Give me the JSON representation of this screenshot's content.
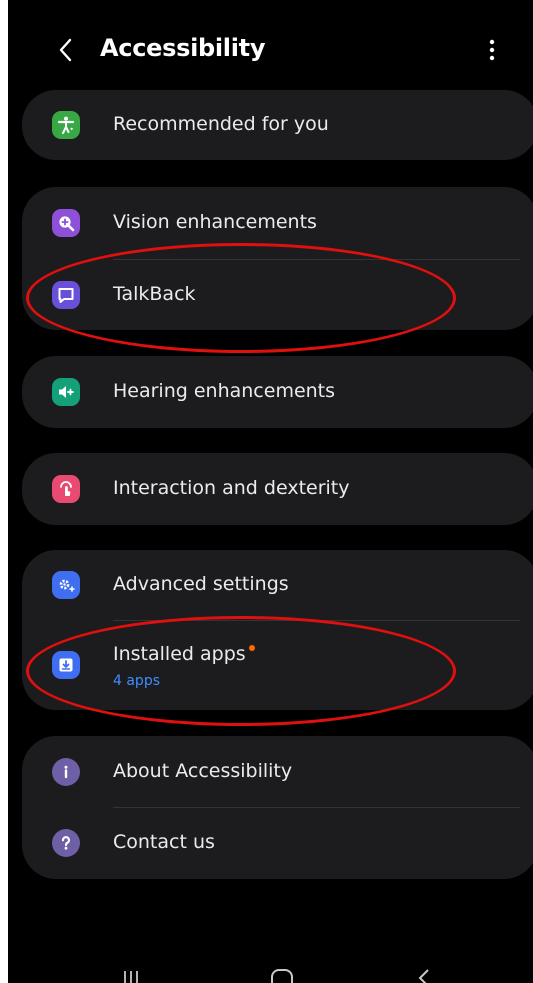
{
  "header": {
    "title": "Accessibility",
    "back_icon": "chevron-left-icon",
    "more_icon": "more-vert-icon"
  },
  "colors": {
    "background": "#000000",
    "card": "#1c1c1e",
    "text": "#ebebeb",
    "subtext": "#3e8eff",
    "badge_dot": "#ff6a00",
    "annotation": "#e0100e"
  },
  "items": [
    {
      "label": "Recommended for you",
      "icon": "accessibility-person-icon",
      "icon_color": "#38a845"
    },
    {
      "label": "Vision enhancements",
      "icon": "zoom-in-icon",
      "icon_color": "#8e4fd9"
    },
    {
      "label": "TalkBack",
      "icon": "chat-bubble-icon",
      "icon_color": "#6a4fd9"
    },
    {
      "label": "Hearing enhancements",
      "icon": "speaker-icon",
      "icon_color": "#14a17a"
    },
    {
      "label": "Interaction and dexterity",
      "icon": "touch-icon",
      "icon_color": "#e84a72"
    },
    {
      "label": "Advanced settings",
      "icon": "gear-plus-icon",
      "icon_color": "#3f6ef0"
    },
    {
      "label": "Installed apps",
      "sublabel": "4 apps",
      "icon": "download-icon",
      "icon_color": "#3f6ef0"
    },
    {
      "label": "About Accessibility",
      "icon": "info-icon",
      "icon_color": "#6e5fa6"
    },
    {
      "label": "Contact us",
      "icon": "help-icon",
      "icon_color": "#6e5fa6"
    }
  ],
  "nav": {
    "recents_icon": "recents-icon",
    "home_icon": "home-icon",
    "back_icon": "nav-back-icon"
  }
}
